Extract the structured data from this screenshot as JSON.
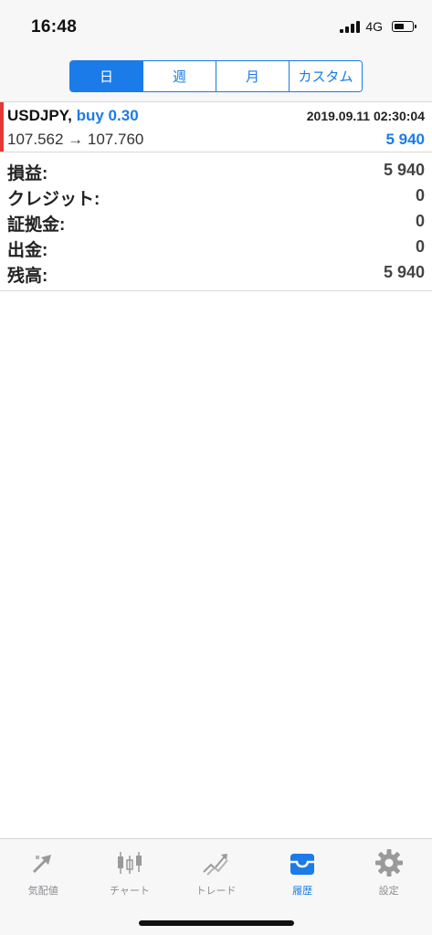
{
  "status_bar": {
    "time": "16:48",
    "network": "4G",
    "icons": [
      "signal-icon",
      "battery-icon"
    ]
  },
  "period_selector": {
    "segments": [
      {
        "label": "日",
        "selected": true
      },
      {
        "label": "週",
        "selected": false
      },
      {
        "label": "月",
        "selected": false
      },
      {
        "label": "カスタム",
        "selected": false
      }
    ]
  },
  "deal": {
    "symbol": "USDJPY,",
    "side": "buy 0.30",
    "time": "2019.09.11 02:30:04",
    "prices": "107.562 → 107.760",
    "profit": "5 940",
    "marker_color": "#e53935"
  },
  "summary": {
    "rows": [
      {
        "label": "損益:",
        "value": "5 940"
      },
      {
        "label": "クレジット:",
        "value": "0"
      },
      {
        "label": "証拠金:",
        "value": "0"
      },
      {
        "label": "出金:",
        "value": "0"
      },
      {
        "label": "残高:",
        "value": "5 940"
      }
    ]
  },
  "tab_bar": {
    "tabs": [
      {
        "label": "気配値",
        "icon": "quotes-icon",
        "active": false
      },
      {
        "label": "チャート",
        "icon": "chart-icon",
        "active": false
      },
      {
        "label": "トレード",
        "icon": "trade-icon",
        "active": false
      },
      {
        "label": "履歴",
        "icon": "history-icon",
        "active": true
      },
      {
        "label": "設定",
        "icon": "settings-icon",
        "active": false
      }
    ]
  },
  "colors": {
    "accent": "#1b7be8",
    "inactive": "#8e8e93",
    "loss_marker": "#e53935"
  }
}
